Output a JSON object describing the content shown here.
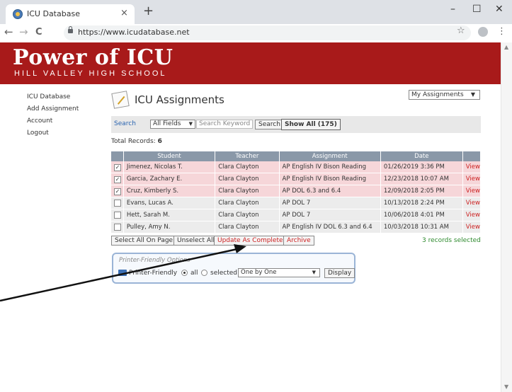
{
  "browser": {
    "tab_title": "ICU Database",
    "tab_close": "×",
    "new_tab": "+",
    "url": "https://www.icudatabase.net",
    "window_controls": {
      "minimize": "–",
      "maximize": "☐",
      "close": "✕"
    },
    "nav": {
      "back": "←",
      "forward": "→",
      "reload": "C"
    }
  },
  "header": {
    "logo": "Power of ICU",
    "subtitle": "HILL VALLEY HIGH SCHOOL",
    "background": "#a81a1a"
  },
  "sidebar": {
    "items": [
      {
        "label": "ICU Database"
      },
      {
        "label": "Add Assignment"
      },
      {
        "label": "Account"
      },
      {
        "label": "Logout"
      }
    ]
  },
  "main": {
    "title": "ICU Assignments",
    "view_select": "My Assignments",
    "search": {
      "label": "Search",
      "fields_value": "All Fields",
      "keyword_placeholder": "Search Keyword",
      "search_button": "Search",
      "show_all_button": "Show All (175)"
    },
    "total_label": "Total Records:",
    "total_value": "6",
    "table": {
      "headers": [
        "Student",
        "Teacher",
        "Assignment",
        "Date"
      ],
      "rows": [
        {
          "checked": true,
          "student": "Jimenez, Nicolas T.",
          "teacher": "Clara Clayton",
          "assignment": "AP English IV Bison Reading",
          "date": "01/26/2019 3:36 PM",
          "action": "View"
        },
        {
          "checked": true,
          "student": "Garcia, Zachary E.",
          "teacher": "Clara Clayton",
          "assignment": "AP English IV Bison Reading",
          "date": "12/23/2018 10:07 AM",
          "action": "View"
        },
        {
          "checked": true,
          "student": "Cruz, Kimberly S.",
          "teacher": "Clara Clayton",
          "assignment": "AP DOL 6.3 and 6.4",
          "date": "12/09/2018 2:05 PM",
          "action": "View"
        },
        {
          "checked": false,
          "student": "Evans, Lucas A.",
          "teacher": "Clara Clayton",
          "assignment": "AP DOL 7",
          "date": "10/13/2018 2:24 PM",
          "action": "View"
        },
        {
          "checked": false,
          "student": "Hett, Sarah M.",
          "teacher": "Clara Clayton",
          "assignment": "AP DOL 7",
          "date": "10/06/2018 4:01 PM",
          "action": "View"
        },
        {
          "checked": false,
          "student": "Pulley, Amy N.",
          "teacher": "Clara Clayton",
          "assignment": "AP English IV DOL 6.3 and 6.4",
          "date": "10/03/2018 10:31 AM",
          "action": "View"
        }
      ]
    },
    "actions": {
      "select_all": "Select All On Page",
      "unselect_all": "Unselect All",
      "update_completed": "Update As Completed",
      "archive": "Archive",
      "selected_count": "3 records selected"
    },
    "printer": {
      "title": "Printer-Friendly Options",
      "label": "Printer-Friendly",
      "radio_all": "all",
      "radio_selected": "selected",
      "order_value": "One by One",
      "display_button": "Display"
    }
  },
  "colors": {
    "selected_row": "#f6d6d9",
    "unselected_row": "#ececec",
    "table_header": "#8a98a8",
    "link_red": "#cc2222",
    "success_green": "#2e8a2e"
  }
}
